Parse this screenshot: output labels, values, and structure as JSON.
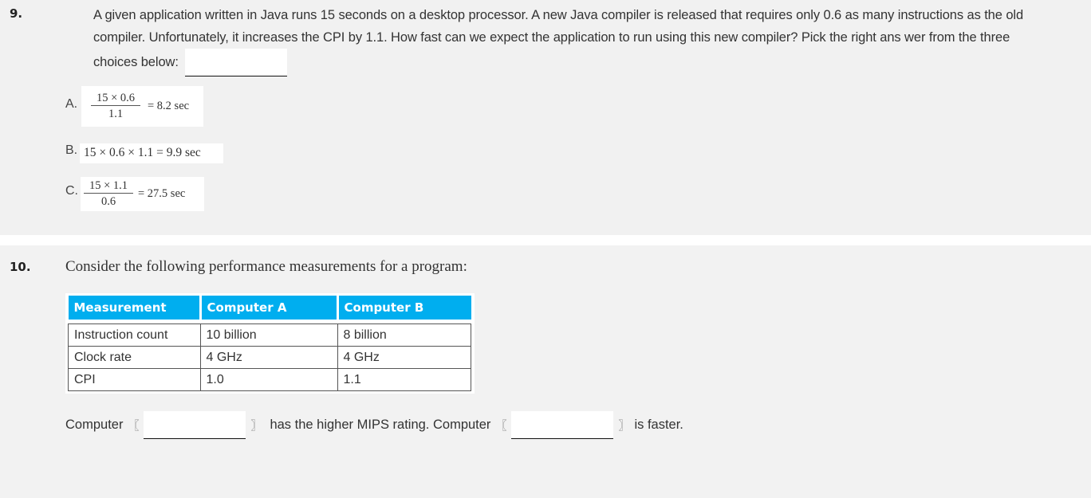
{
  "question9": {
    "number": "9.",
    "text": "A given application written in Java runs 15 seconds on a desktop processor. A new Java compiler is released that requires only 0.6 as many instructions as the old compiler. Unfortunately, it increases the CPI by 1.1. How fast can we expect the application to run using this new compiler? Pick the right ans wer from the three choices below:",
    "answer_value": "",
    "choices": [
      {
        "letter": "A.",
        "numerator": "15 × 0.6",
        "denominator": "1.1",
        "result": "= 8.2 sec"
      },
      {
        "letter": "B.",
        "expression": "15 × 0.6 × 1.1 = 9.9 sec"
      },
      {
        "letter": "C.",
        "numerator": "15 × 1.1",
        "denominator": "0.6",
        "result": "= 27.5 sec"
      }
    ]
  },
  "question10": {
    "number": "10.",
    "text": "Consider the following performance measurements for a program:",
    "table": {
      "headers": [
        "Measurement",
        "Computer A",
        "Computer B"
      ],
      "rows": [
        [
          "Instruction count",
          "10 billion",
          "8 billion"
        ],
        [
          "Clock rate",
          "4 GHz",
          "4 GHz"
        ],
        [
          "CPI",
          "1.0",
          "1.1"
        ]
      ],
      "header_color": "#00aeef"
    },
    "sentence": {
      "part1": "Computer",
      "part2": "has the higher MIPS rating. Computer",
      "part3": "is faster.",
      "open_bracket": "〖",
      "close_bracket": "〗",
      "blank1_value": "",
      "blank2_value": ""
    }
  }
}
